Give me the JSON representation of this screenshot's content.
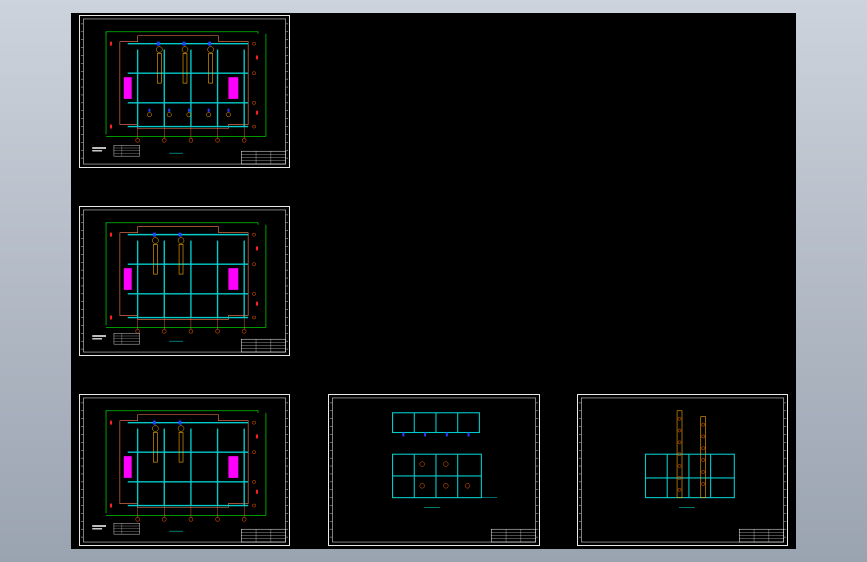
{
  "app": {
    "background": "#b4bcc8",
    "model_space_color": "#000000"
  },
  "colors": {
    "frame": "#ffffff",
    "grid": "#00cccc",
    "wall": "#ff7f50",
    "green_line": "#00c800",
    "pipe": "#ffb000",
    "equipment": "#ff00ff",
    "marker": "#ff6000",
    "accent_blue": "#2040ff",
    "text_yellow": "#ffff00",
    "red": "#ff2020"
  },
  "sheets": [
    {
      "id": "sheet-1",
      "kind": "floor-plan",
      "variant": "full"
    },
    {
      "id": "sheet-2",
      "kind": "floor-plan",
      "variant": "partial"
    },
    {
      "id": "sheet-3",
      "kind": "floor-plan",
      "variant": "partial"
    },
    {
      "id": "sheet-4",
      "kind": "detail-plan"
    },
    {
      "id": "sheet-5",
      "kind": "elevation"
    }
  ]
}
